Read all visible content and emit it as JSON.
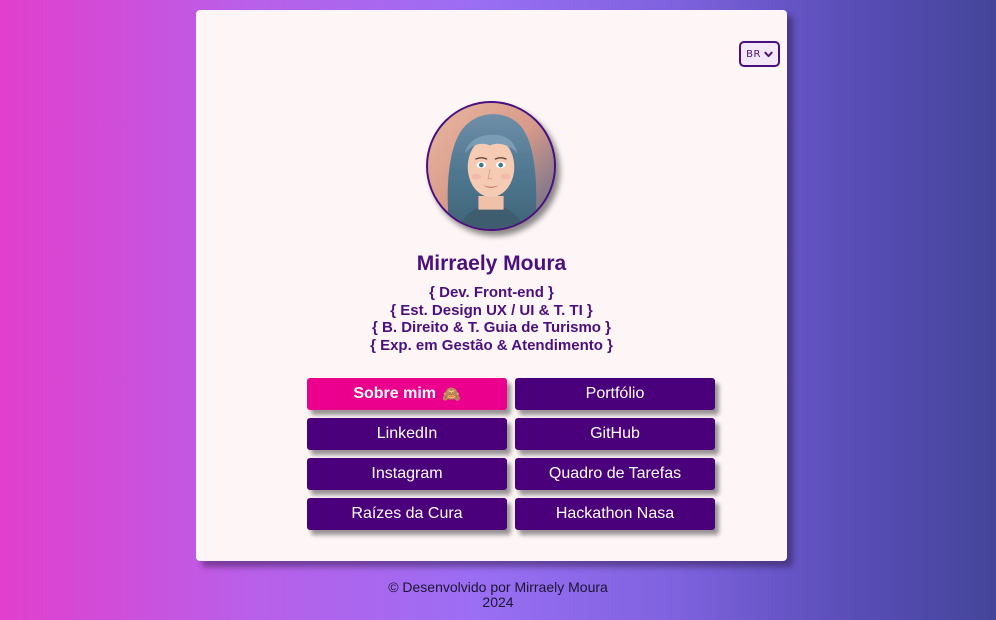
{
  "language_select": {
    "value": "BR",
    "icon": "chevron-down-icon"
  },
  "profile": {
    "avatar_alt": "Mirraely Moura",
    "name": "Mirraely Moura",
    "roles": [
      "{ Dev. Front-end }",
      "{ Est. Design UX / UI & T. TI }",
      "{ B. Direito & T. Guia de Turismo }",
      "{ Exp. em Gestão & Atendimento }"
    ]
  },
  "links": [
    {
      "label": "Sobre mim",
      "emoji": "🙈",
      "active": true
    },
    {
      "label": "Portfólio"
    },
    {
      "label": "LinkedIn"
    },
    {
      "label": "GitHub"
    },
    {
      "label": "Instagram"
    },
    {
      "label": "Quadro de Tarefas"
    },
    {
      "label": "Raízes da Cura"
    },
    {
      "label": "Hackathon Nasa"
    }
  ],
  "footer": {
    "credit": "© Desenvolvido por Mirraely Moura",
    "year": "2024"
  },
  "colors": {
    "accent": "#4a007a",
    "active": "#ea008c",
    "card": "#fdf5f6",
    "text": "#4b0f7e"
  }
}
